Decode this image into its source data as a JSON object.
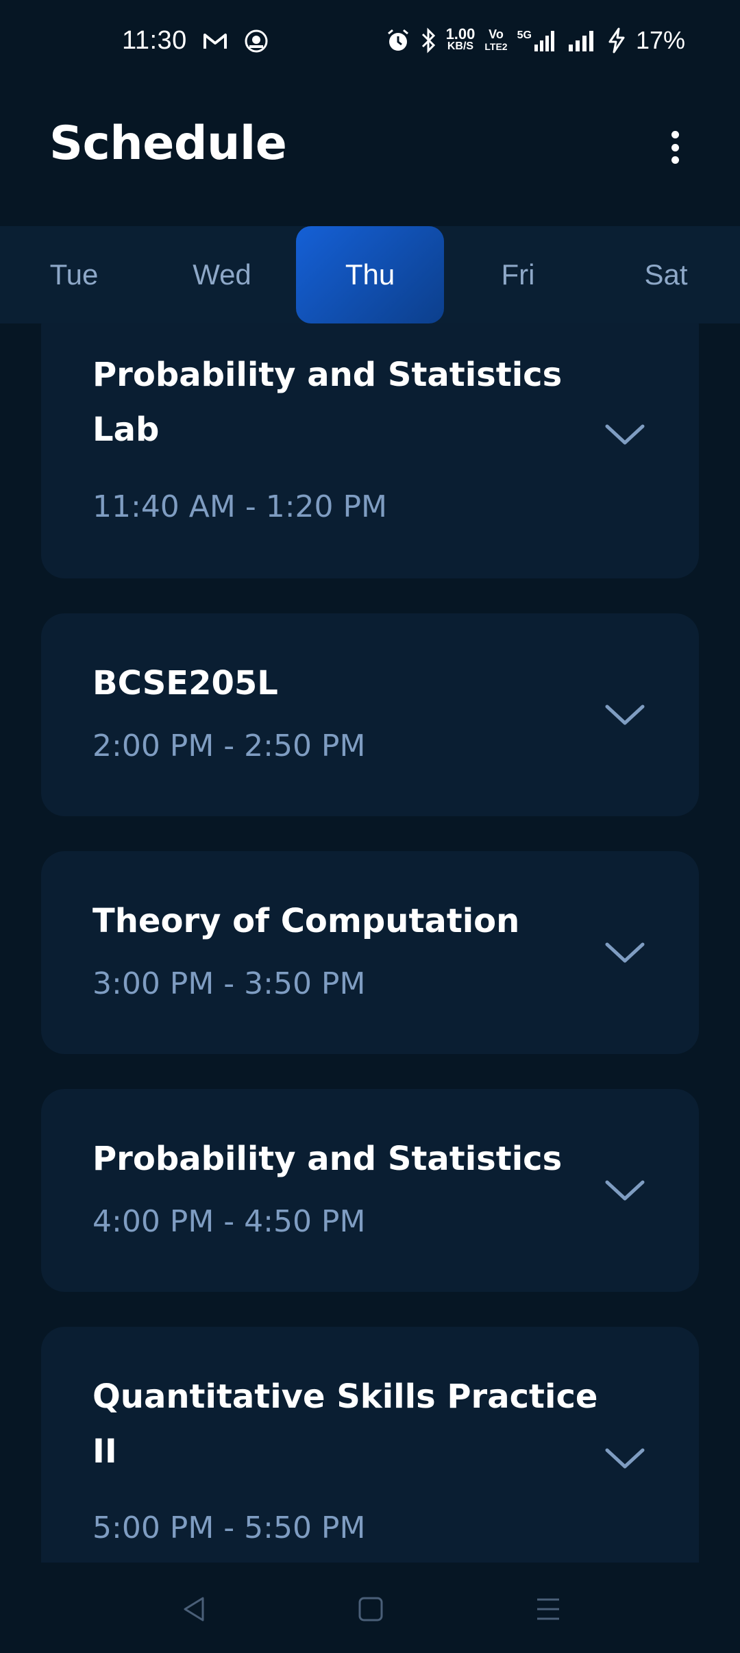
{
  "status_bar": {
    "time": "11:30",
    "net_speed_value": "1.00",
    "net_speed_unit": "KB/S",
    "volte_top": "Vo",
    "volte_bottom": "LTE2",
    "network": "5G",
    "battery": "17%",
    "icons": [
      "gmail-icon",
      "app-notification-icon",
      "alarm-icon",
      "bluetooth-icon",
      "signal-icon",
      "signal-icon-2",
      "charging-icon"
    ]
  },
  "header": {
    "title": "Schedule",
    "menu_icon": "more-vertical-icon"
  },
  "days": {
    "items": [
      "Tue",
      "Wed",
      "Thu",
      "Fri",
      "Sat"
    ],
    "selected": "Thu",
    "accent": "#1560d6"
  },
  "classes": [
    {
      "title": "Probability and Statistics Lab",
      "time": "11:40 AM - 1:20 PM"
    },
    {
      "title": "BCSE205L",
      "time": "2:00 PM - 2:50 PM"
    },
    {
      "title": "Theory of Computation",
      "time": "3:00 PM - 3:50 PM"
    },
    {
      "title": "Probability and Statistics",
      "time": "4:00 PM - 4:50 PM"
    },
    {
      "title": "Quantitative Skills Practice II",
      "time": "5:00 PM - 5:50 PM"
    }
  ],
  "nav": {
    "icons": [
      "back-icon",
      "home-icon",
      "recents-icon"
    ]
  }
}
